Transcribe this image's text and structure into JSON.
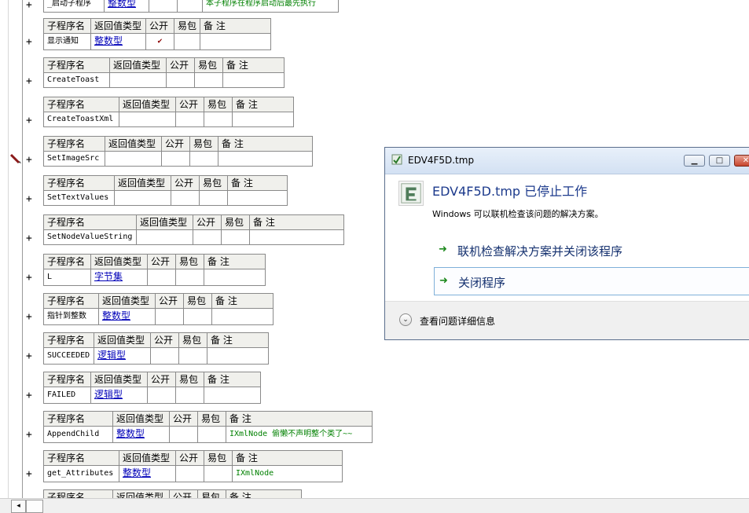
{
  "headers": {
    "name": "子程序名",
    "rettype": "返回值类型",
    "public": "公开",
    "easy": "易包",
    "remark": "备 注"
  },
  "gutter": {
    "expand_symbol": "+"
  },
  "top_partial": {
    "name": "_启动子程序",
    "rettype": "整数型",
    "remark": "本子程序在程序启动后最先执行"
  },
  "subroutines": [
    {
      "name": "显示通知",
      "rettype": "整数型",
      "public": "✔",
      "remark": ""
    },
    {
      "name": "CreateToast",
      "rettype": "",
      "public": "",
      "remark": ""
    },
    {
      "name": "CreateToastXml",
      "rettype": "",
      "public": "",
      "remark": ""
    },
    {
      "name": "SetImageSrc",
      "rettype": "",
      "public": "",
      "remark": ""
    },
    {
      "name": "SetTextValues",
      "rettype": "",
      "public": "",
      "remark": ""
    },
    {
      "name": "SetNodeValueString",
      "rettype": "",
      "public": "",
      "remark": ""
    },
    {
      "name": "L",
      "rettype": "字节集",
      "public": "",
      "remark": ""
    },
    {
      "name": "指针到整数",
      "rettype": "整数型",
      "public": "",
      "remark": ""
    },
    {
      "name": "SUCCEEDED",
      "rettype": "逻辑型",
      "public": "",
      "remark": ""
    },
    {
      "name": "FAILED",
      "rettype": "逻辑型",
      "public": "",
      "remark": ""
    },
    {
      "name": "AppendChild",
      "rettype": "整数型",
      "public": "",
      "remark": "IXmlNode 偷懒不声明整个类了~~"
    },
    {
      "name": "get_Attributes",
      "rettype": "整数型",
      "public": "",
      "remark": "IXmlNode"
    }
  ],
  "dialog": {
    "title": "EDV4F5D.tmp",
    "heading": "EDV4F5D.tmp 已停止工作",
    "subtext": "Windows 可以联机检查该问题的解决方案。",
    "option_check": "联机检查解决方案并关闭该程序",
    "option_close": "关闭程序",
    "details": "查看问题详细信息",
    "minimize_glyph": "▁",
    "maximize_glyph": "□",
    "close_glyph": "✕",
    "arrow_glyph": "➜",
    "chevron_glyph": "⌄"
  },
  "scrollbar": {
    "left_glyph": "◂"
  },
  "colors": {
    "type_link": "#0000b8",
    "remark_text": "#008000",
    "dialog_heading": "#1c3a8c"
  }
}
